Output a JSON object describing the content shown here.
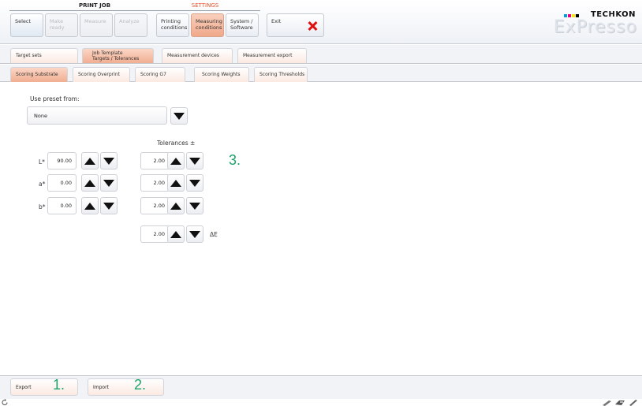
{
  "header": {
    "print_job_title": "PRINT JOB",
    "settings_title": "SETTINGS",
    "buttons": {
      "select": "Select",
      "make_ready": "Make ready",
      "measure": "Measure",
      "analyze": "Analyze",
      "printing_conditions_1": "Printing",
      "printing_conditions_2": "conditions",
      "measuring_conditions_1": "Measuring",
      "measuring_conditions_2": "conditions",
      "system_software_1": "System /",
      "system_software_2": "Software",
      "exit": "Exit"
    },
    "logo_brand": "TECHKON",
    "logo_product": "ExPresso",
    "logo_colors": [
      "#00a0e0",
      "#e6007e",
      "#ffe600",
      "#000000"
    ],
    "settings_title_color": "#e8502a"
  },
  "tabs_row1": [
    "Target sets",
    "Job Template",
    "Targets / Tolerances",
    "Measurement devices",
    "Measurement export"
  ],
  "tabs_row2": [
    "Scoring Substrate",
    "Scoring Overprint",
    "Scoring G7",
    "Scoring Weights",
    "Scoring Thresholds"
  ],
  "content": {
    "preset_label": "Use preset from:",
    "preset_value": "None",
    "tolerances_label": "Tolerances ±",
    "rows": [
      {
        "label": "L*",
        "value": "90.00",
        "tolerance": "2.00"
      },
      {
        "label": "a*",
        "value": "0.00",
        "tolerance": "2.00"
      },
      {
        "label": "b*",
        "value": "0.00",
        "tolerance": "2.00"
      }
    ],
    "delta_e_value": "2.00",
    "delta_e_label": "ΔE",
    "step3": "3."
  },
  "bottom": {
    "export": "Export",
    "import": "Import",
    "step1": "1.",
    "step2": "2."
  },
  "icons": [
    "refresh-icon",
    "device-icon",
    "device-icon",
    "pen-icon"
  ],
  "colors": {
    "accent_orange": "#f1ae92",
    "step_green": "#1aa36a",
    "exit_red": "#e01010"
  }
}
